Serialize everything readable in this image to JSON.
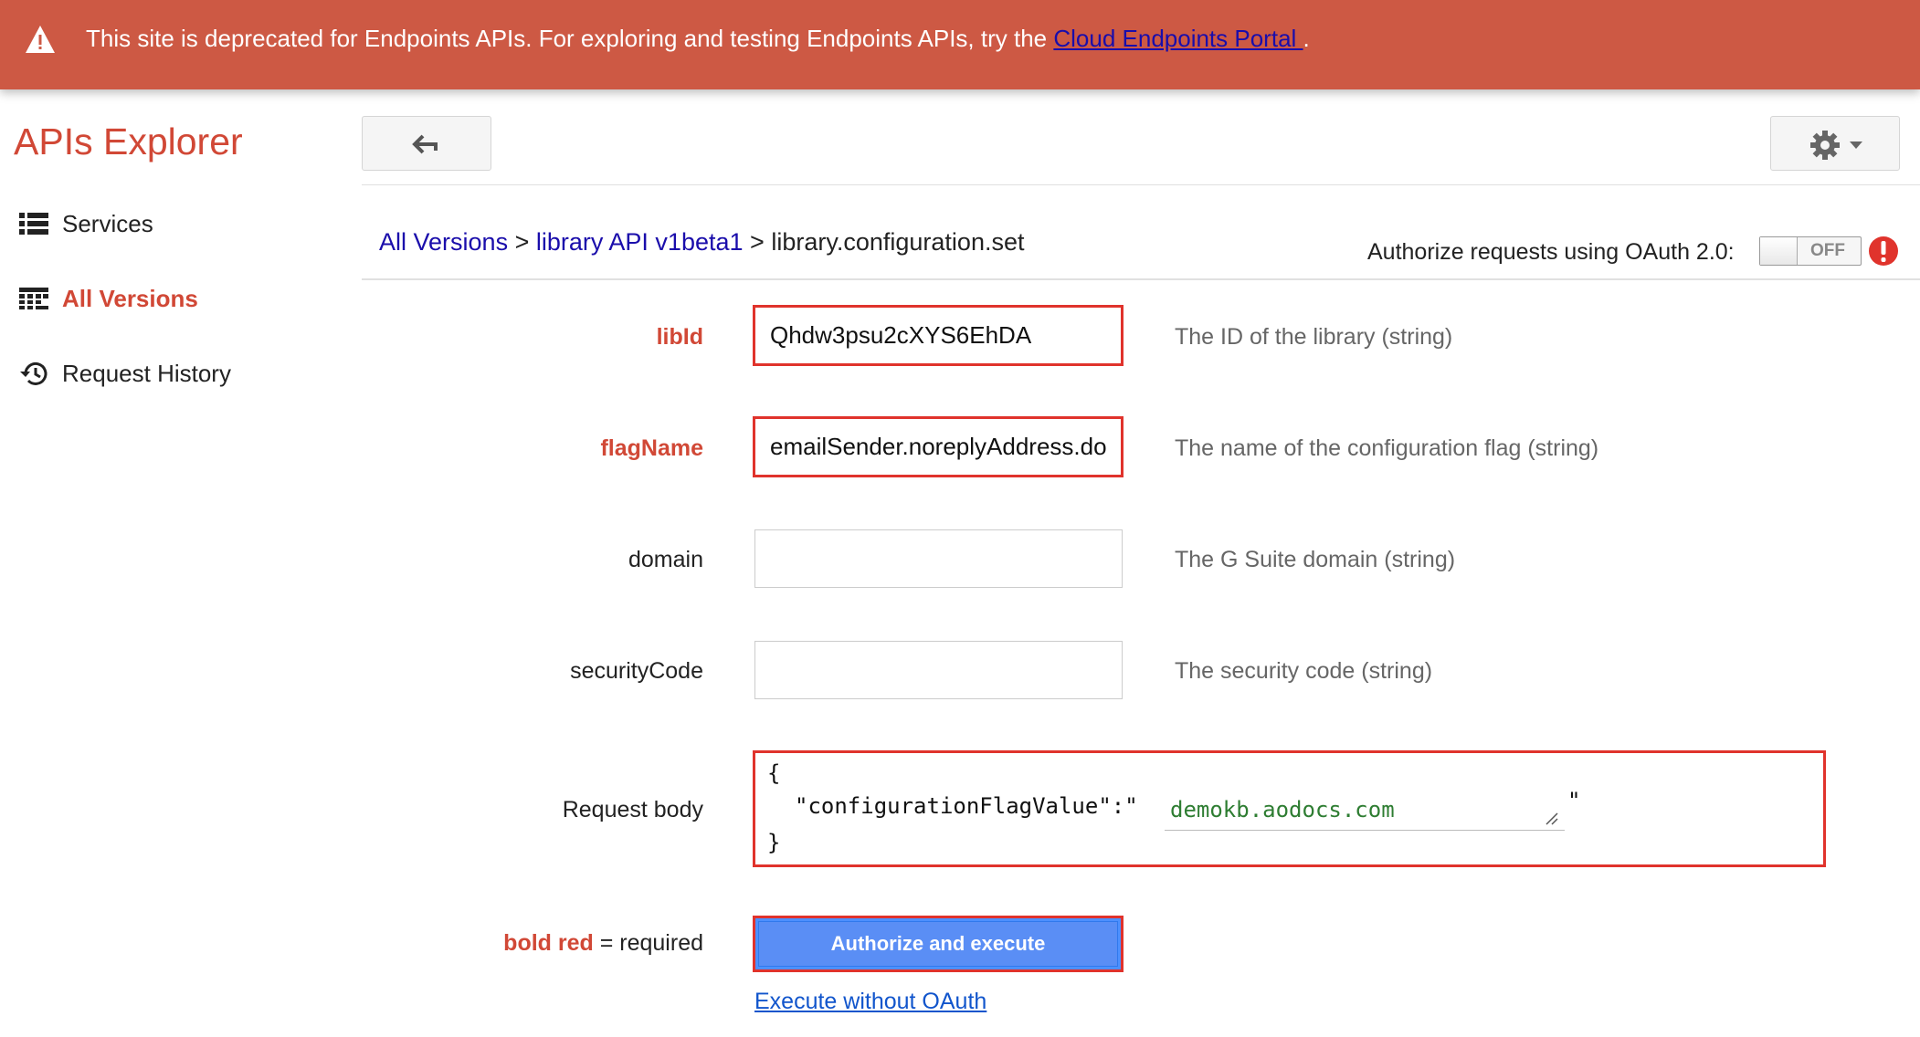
{
  "banner": {
    "message": "This site is deprecated for Endpoints APIs. For exploring and testing Endpoints APIs, try the",
    "link_text": "Cloud Endpoints Portal ",
    "suffix": ".",
    "icon": "warning-icon"
  },
  "app": {
    "title": "APIs Explorer"
  },
  "toolbar": {
    "back_icon": "back-arrow-icon",
    "settings_icon": "gear-icon"
  },
  "sidebar": {
    "items": [
      {
        "label": "Services",
        "icon": "list-icon",
        "active": false
      },
      {
        "label": "All Versions",
        "icon": "versions-icon",
        "active": true
      },
      {
        "label": "Request History",
        "icon": "history-icon",
        "active": false
      }
    ]
  },
  "breadcrumb": {
    "items": [
      "All Versions",
      "library API v1beta1",
      "library.configuration.set"
    ],
    "separator": ">"
  },
  "oauth": {
    "label": "Authorize requests using OAuth 2.0:",
    "toggle_state": "OFF"
  },
  "params": [
    {
      "name": "libId",
      "required": true,
      "value": "Qhdw3psu2cXYS6EhDA",
      "description": "The ID of the library (string)"
    },
    {
      "name": "flagName",
      "required": true,
      "value": "emailSender.noreplyAddress.do",
      "description": "The name of the configuration flag (string)"
    },
    {
      "name": "domain",
      "required": false,
      "value": "",
      "description": "The G Suite domain (string)"
    },
    {
      "name": "securityCode",
      "required": false,
      "value": "",
      "description": "The security code (string)"
    }
  ],
  "request_body": {
    "label": "Request body",
    "open_brace": "{",
    "key": "\"configurationFlagValue\":\"",
    "value": "demokb.aodocs.com",
    "close_quote": "\"",
    "close_brace": "}"
  },
  "legend": {
    "bold_red": "bold red",
    "rest": " = required"
  },
  "actions": {
    "execute_label": "Authorize and execute",
    "execute_no_oauth": "Execute without OAuth"
  },
  "colors": {
    "banner": "#cd5944",
    "accent_red": "#d14836",
    "link": "#1a0dab",
    "button_blue": "#5a8ef5",
    "highlight": "#e0332c"
  }
}
